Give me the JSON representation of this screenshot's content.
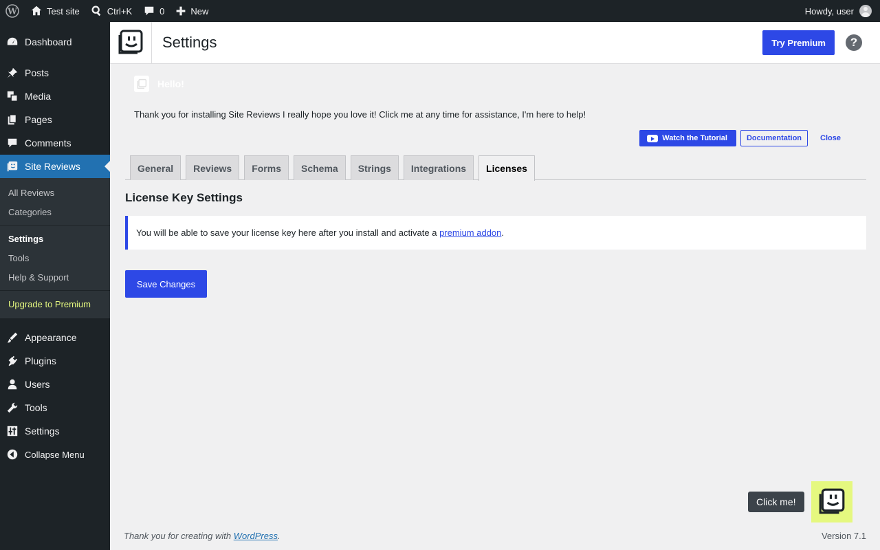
{
  "adminbar": {
    "site_name": "Test site",
    "search_shortcut": "Ctrl+K",
    "comments_count": "0",
    "new_label": "New",
    "greeting": "Howdy, user"
  },
  "sidebar": {
    "items_top": [
      {
        "label": "Dashboard",
        "icon": "dashboard-icon"
      },
      {
        "label": "Posts",
        "icon": "pin-icon"
      },
      {
        "label": "Media",
        "icon": "media-icon"
      },
      {
        "label": "Pages",
        "icon": "pages-icon"
      },
      {
        "label": "Comments",
        "icon": "comment-icon"
      },
      {
        "label": "Site Reviews",
        "icon": "site-reviews-icon"
      }
    ],
    "submenu": [
      "All Reviews",
      "Categories",
      "Settings",
      "Tools",
      "Help & Support",
      "Upgrade to Premium"
    ],
    "items_bottom": [
      {
        "label": "Appearance",
        "icon": "brush-icon"
      },
      {
        "label": "Plugins",
        "icon": "plug-icon"
      },
      {
        "label": "Users",
        "icon": "user-icon"
      },
      {
        "label": "Tools",
        "icon": "wrench-icon"
      },
      {
        "label": "Settings",
        "icon": "sliders-icon"
      },
      {
        "label": "Collapse Menu",
        "icon": "collapse-icon"
      }
    ]
  },
  "header": {
    "title": "Settings",
    "premium_button": "Try Premium",
    "help": "?"
  },
  "notice": {
    "hello": "Hello!",
    "message": "Thank you for installing Site Reviews I really hope you love it! Click me at any time for assistance, I'm here to help!",
    "tutorial_button": "Watch the Tutorial",
    "docs_button": "Documentation",
    "close_button": "Close"
  },
  "tabs": [
    "General",
    "Reviews",
    "Forms",
    "Schema",
    "Strings",
    "Integrations",
    "Licenses"
  ],
  "active_tab": "Licenses",
  "content": {
    "section_title": "License Key Settings",
    "info_prefix": "You will be able to save your license key here after you install and activate a ",
    "info_link": "premium addon",
    "info_suffix": ".",
    "save_button": "Save Changes"
  },
  "assistant": {
    "bubble": "Click me!"
  },
  "footer": {
    "thanks_prefix": "Thank you for creating with ",
    "thanks_link": "WordPress",
    "thanks_suffix": ".",
    "version": "Version 7.1"
  },
  "colors": {
    "accent": "#2d48e6",
    "assistant_bg": "#e5f87f",
    "admin_dark": "#1d2327"
  }
}
